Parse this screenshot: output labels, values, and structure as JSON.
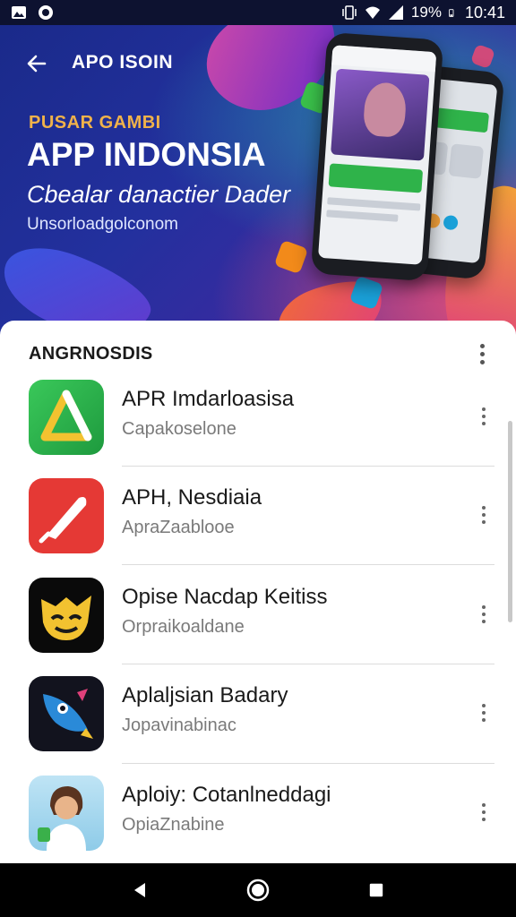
{
  "status_bar": {
    "battery": "19%",
    "time": "10:41",
    "icons": [
      "gallery-icon",
      "notification-icon",
      "vibrate-icon",
      "wifi-icon",
      "signal-icon",
      "battery-icon"
    ]
  },
  "banner": {
    "topbar_title": "APO ISOIN",
    "overline": "PUSAR GAMBI",
    "title": "APP INDONSIA",
    "subtitle": "Cbealar danactier Dader",
    "url": "Unsorloadgolconom",
    "colors": {
      "overline": "#f0b24a",
      "background_start": "#1a2a8a",
      "background_end": "#7a2a8a"
    }
  },
  "list": {
    "section_title": "ANGRNOSDIS",
    "items": [
      {
        "name": "APR Imdarloasisa",
        "subtitle": "Capakoselone",
        "icon": "triangle-logo-icon",
        "icon_color": "#2fb34a"
      },
      {
        "name": "APH, Nesdiaia",
        "subtitle": "ApraZaablooe",
        "icon": "rocket-logo-icon",
        "icon_color": "#e53935"
      },
      {
        "name": "Opise Nacdap Keitiss",
        "subtitle": "Orpraikoaldane",
        "icon": "cat-face-icon",
        "icon_color": "#f2c230"
      },
      {
        "name": "Aplaljsian Badary",
        "subtitle": "Jopavinabinac",
        "icon": "rocket-fish-icon",
        "icon_color": "#1a1a2e"
      },
      {
        "name": "Aploiy: Cotanlneddagi",
        "subtitle": "OpiaZnabine",
        "icon": "girl-avatar-icon",
        "icon_color": "#a8d8f0"
      }
    ]
  },
  "nav": {
    "buttons": [
      "back-nav-icon",
      "home-nav-icon",
      "recents-nav-icon"
    ]
  }
}
